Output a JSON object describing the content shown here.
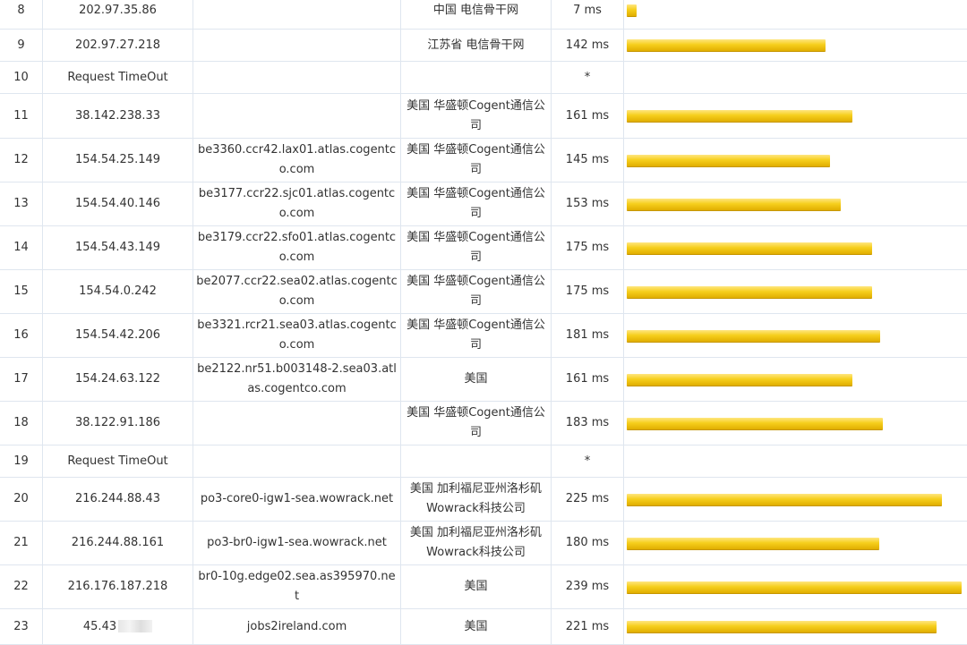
{
  "rows": [
    {
      "hop": "8",
      "ip": "202.97.35.86",
      "host": "",
      "location": "中国 电信骨干网",
      "time": "7 ms",
      "ms": 7
    },
    {
      "hop": "9",
      "ip": "202.97.27.218",
      "host": "",
      "location": "江苏省 电信骨干网",
      "time": "142 ms",
      "ms": 142
    },
    {
      "hop": "10",
      "ip": "Request TimeOut",
      "host": "",
      "location": "",
      "time": "*",
      "ms": 0
    },
    {
      "hop": "11",
      "ip": "38.142.238.33",
      "host": "",
      "location": "美国 华盛顿Cogent通信公司",
      "time": "161 ms",
      "ms": 161
    },
    {
      "hop": "12",
      "ip": "154.54.25.149",
      "host": "be3360.ccr42.lax01.atlas.cogentco.com",
      "location": "美国 华盛顿Cogent通信公司",
      "time": "145 ms",
      "ms": 145
    },
    {
      "hop": "13",
      "ip": "154.54.40.146",
      "host": "be3177.ccr22.sjc01.atlas.cogentco.com",
      "location": "美国 华盛顿Cogent通信公司",
      "time": "153 ms",
      "ms": 153
    },
    {
      "hop": "14",
      "ip": "154.54.43.149",
      "host": "be3179.ccr22.sfo01.atlas.cogentco.com",
      "location": "美国 华盛顿Cogent通信公司",
      "time": "175 ms",
      "ms": 175
    },
    {
      "hop": "15",
      "ip": "154.54.0.242",
      "host": "be2077.ccr22.sea02.atlas.cogentco.com",
      "location": "美国 华盛顿Cogent通信公司",
      "time": "175 ms",
      "ms": 175
    },
    {
      "hop": "16",
      "ip": "154.54.42.206",
      "host": "be3321.rcr21.sea03.atlas.cogentco.com",
      "location": "美国 华盛顿Cogent通信公司",
      "time": "181 ms",
      "ms": 181
    },
    {
      "hop": "17",
      "ip": "154.24.63.122",
      "host": "be2122.nr51.b003148-2.sea03.atlas.cogentco.com",
      "location": "美国",
      "time": "161 ms",
      "ms": 161
    },
    {
      "hop": "18",
      "ip": "38.122.91.186",
      "host": "",
      "location": "美国 华盛顿Cogent通信公司",
      "time": "183 ms",
      "ms": 183
    },
    {
      "hop": "19",
      "ip": "Request TimeOut",
      "host": "",
      "location": "",
      "time": "*",
      "ms": 0
    },
    {
      "hop": "20",
      "ip": "216.244.88.43",
      "host": "po3-core0-igw1-sea.wowrack.net",
      "location": "美国 加利福尼亚州洛杉矶Wowrack科技公司",
      "time": "225 ms",
      "ms": 225
    },
    {
      "hop": "21",
      "ip": "216.244.88.161",
      "host": "po3-br0-igw1-sea.wowrack.net",
      "location": "美国 加利福尼亚州洛杉矶Wowrack科技公司",
      "time": "180 ms",
      "ms": 180
    },
    {
      "hop": "22",
      "ip": "216.176.187.218",
      "host": "br0-10g.edge02.sea.as395970.net",
      "location": "美国",
      "time": "239 ms",
      "ms": 239
    },
    {
      "hop": "23",
      "ip": "45.43",
      "host": "jobs2ireland.com",
      "location": "美国",
      "time": "221 ms",
      "ms": 221,
      "masked": true
    }
  ],
  "bar_scale_max_ms": 239,
  "colors": {
    "bar": "#f6cf1c",
    "grid": "#dfe6ef"
  }
}
